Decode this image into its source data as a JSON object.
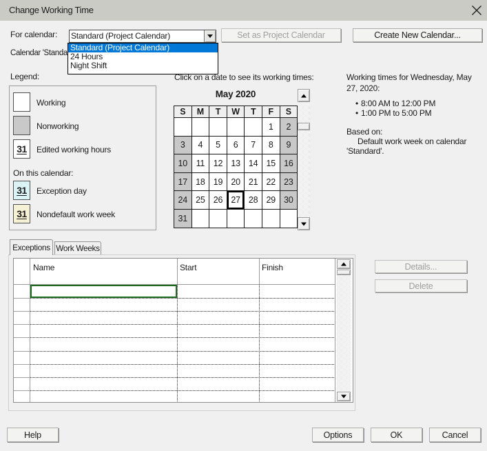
{
  "window": {
    "title": "Change Working Time"
  },
  "toolbar": {
    "for_calendar_label": "For calendar:",
    "combobox_value": "Standard (Project Calendar)",
    "dropdown_options": [
      "Standard (Project Calendar)",
      "24 Hours",
      "Night Shift"
    ],
    "dropdown_selected_index": 0,
    "set_as_project_calendar_label": "Set as Project Calendar",
    "create_new_calendar_label": "Create New Calendar..."
  },
  "calendar_note_fragment": "Calendar 'Standa",
  "legend": {
    "label": "Legend:",
    "working_label": "Working",
    "nonworking_label": "Nonworking",
    "edited_label": "Edited working hours",
    "on_this_calendar_label": "On this calendar:",
    "exception_label": "Exception day",
    "nondefault_label": "Nondefault work week",
    "swatch_number": "31"
  },
  "calendar": {
    "hint": "Click on a date to see its working times:",
    "month_title": "May 2020",
    "day_headers": [
      "S",
      "M",
      "T",
      "W",
      "T",
      "F",
      "S"
    ],
    "weeks": [
      [
        "",
        "",
        "",
        "",
        "",
        "1",
        "2"
      ],
      [
        "3",
        "4",
        "5",
        "6",
        "7",
        "8",
        "9"
      ],
      [
        "10",
        "11",
        "12",
        "13",
        "14",
        "15",
        "16"
      ],
      [
        "17",
        "18",
        "19",
        "20",
        "21",
        "22",
        "23"
      ],
      [
        "24",
        "25",
        "26",
        "27",
        "28",
        "29",
        "30"
      ],
      [
        "31",
        "",
        "",
        "",
        "",
        "",
        ""
      ]
    ],
    "selected_day": "27",
    "weekend_columns": [
      0,
      6
    ]
  },
  "working_times": {
    "heading": "Working times for Wednesday, May 27, 2020:",
    "bullets": [
      "8:00 AM to 12:00 PM",
      "1:00 PM to 5:00 PM"
    ],
    "based_on_label": "Based on:",
    "based_on_text": "Default work week on calendar 'Standard'."
  },
  "tabs": {
    "exceptions_label": "Exceptions",
    "work_weeks_label": "Work Weeks",
    "active_tab": "Exceptions"
  },
  "exceptions_table": {
    "columns": [
      "Name",
      "Start",
      "Finish"
    ],
    "row_count": 9,
    "selected_cell": {
      "row": 1,
      "column": "Name"
    }
  },
  "side_buttons": {
    "details_label": "Details...",
    "delete_label": "Delete"
  },
  "bottom_buttons": {
    "help_label": "Help",
    "options_label": "Options",
    "ok_label": "OK",
    "cancel_label": "Cancel"
  },
  "colors": {
    "titlebar": "#cbcbc5",
    "dialog_bg": "#f0f0f0",
    "highlight_blue": "#0078d7",
    "selection_green": "#1d6b1d",
    "weekend_gray": "#c8c8c8",
    "exception_cyan": "#daf3f8",
    "nondefault_yellow": "#f9f4da"
  }
}
